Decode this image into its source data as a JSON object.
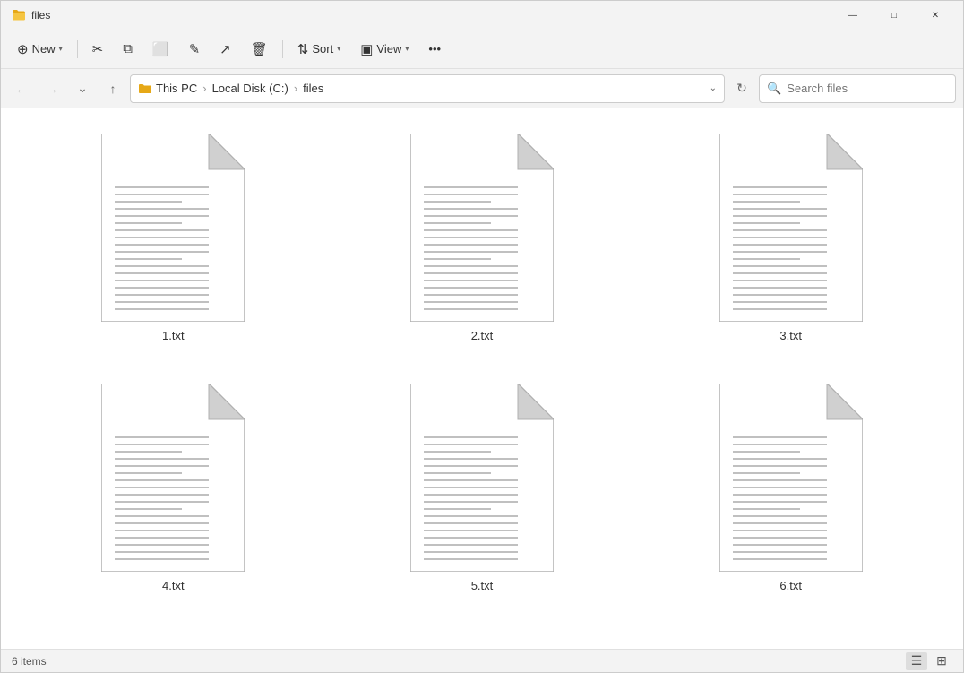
{
  "titlebar": {
    "title": "files",
    "min_label": "—",
    "max_label": "□",
    "close_label": "✕"
  },
  "toolbar": {
    "new_label": "New",
    "sort_label": "Sort",
    "view_label": "View",
    "more_label": "•••",
    "cut_icon": "✂",
    "copy_icon": "⧉",
    "paste_icon": "📋",
    "share_icon": "↗",
    "delete_icon": "🗑",
    "rename_icon": "✎"
  },
  "addressbar": {
    "back_icon": "←",
    "forward_icon": "→",
    "dropdown_icon": "⌄",
    "up_icon": "↑",
    "breadcrumbs": [
      "This PC",
      "Local Disk (C:)",
      "files"
    ],
    "refresh_icon": "↻",
    "search_placeholder": "Search files"
  },
  "files": [
    {
      "name": "1.txt"
    },
    {
      "name": "2.txt"
    },
    {
      "name": "3.txt"
    },
    {
      "name": "4.txt"
    },
    {
      "name": "5.txt"
    },
    {
      "name": "6.txt"
    }
  ],
  "statusbar": {
    "items_count": "6 items",
    "list_view_icon": "☰",
    "grid_view_icon": "⊞"
  }
}
